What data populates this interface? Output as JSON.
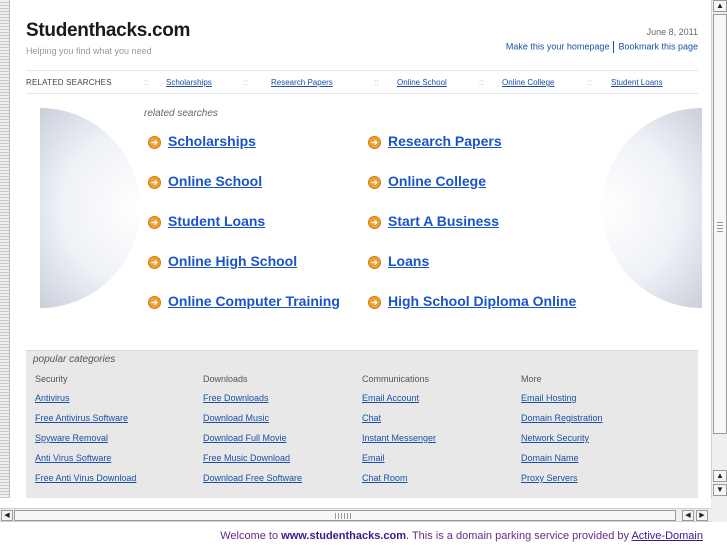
{
  "header": {
    "title": "Studenthacks.com",
    "tagline": "Helping you find what you need",
    "date": "June 8, 2011",
    "homepage_link": "Make this your homepage",
    "bookmark_link": "Bookmark this page"
  },
  "related_bar": {
    "label": "RELATED SEARCHES",
    "separator": "::",
    "links": [
      "Scholarships",
      "Research Papers",
      "Online School",
      "Online College",
      "Student Loans"
    ]
  },
  "related_searches": {
    "heading": "related searches",
    "arrow_glyph": "➔",
    "items": [
      "Scholarships",
      "Research Papers",
      "Online School",
      "Online College",
      "Student Loans",
      "Start A Business",
      "Online High School",
      "Loans",
      "Online Computer Training",
      "High School Diploma Online"
    ]
  },
  "popular": {
    "heading": "popular categories",
    "columns": [
      {
        "title": "Security",
        "links": [
          "Antivirus",
          "Free Antivirus Software",
          "Spyware Removal",
          "Anti Virus Software",
          "Free Anti Virus Download"
        ]
      },
      {
        "title": "Downloads",
        "links": [
          "Free Downloads",
          "Download Music",
          "Download Full Movie",
          "Free Music Download",
          "Download Free Software"
        ]
      },
      {
        "title": "Communications",
        "links": [
          "Email Account",
          "Chat",
          "Instant Messenger",
          "Email",
          "Chat Room"
        ]
      },
      {
        "title": "More",
        "links": [
          "Email Hosting",
          "Domain Registration",
          "Network Security",
          "Domain Name",
          "Proxy Servers"
        ]
      }
    ]
  },
  "footer": {
    "prefix": "Welcome to ",
    "domain": "www.studenthacks.com",
    "middle": ". This is a domain parking service provided by ",
    "provider": "Active-Domain"
  },
  "colors": {
    "link": "#1a55c8",
    "arrow": "#f0a030",
    "panel": "#e8e8e8"
  }
}
